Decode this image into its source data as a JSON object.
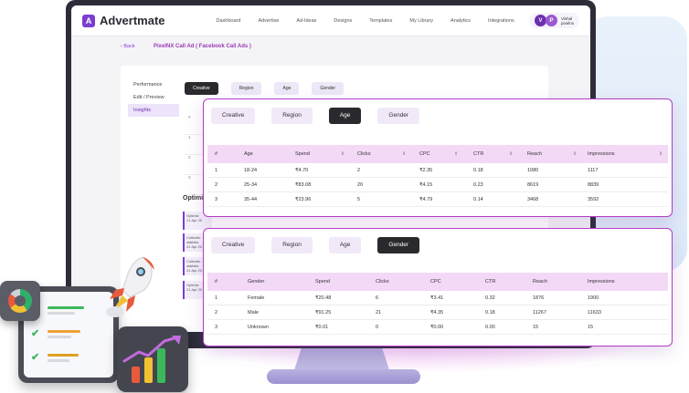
{
  "app": {
    "logo": "Advertmate",
    "nav": [
      "Dashboard",
      "Advertise",
      "Ad-Ideas",
      "Designs",
      "Templates",
      "My Library",
      "Analytics",
      "Integrations"
    ],
    "user": {
      "initial_1": "V",
      "initial_2": "P",
      "name": "Vishal",
      "sub": "pixelnx"
    },
    "back": "Back",
    "title": "PixelNX Call Ad ( Facebook Call Ads )"
  },
  "sidebar": {
    "items": [
      "Performance",
      "Edit / Preview",
      "Insights"
    ]
  },
  "bg_tabs": [
    "Creative",
    "Region",
    "Age",
    "Gender"
  ],
  "bg_rows": [
    "#",
    "1",
    "2",
    "3"
  ],
  "bg_opt": {
    "title": "Optimiz",
    "cards": [
      {
        "t": "Optimiz",
        "d": "21 Apr 20"
      },
      {
        "t": "Collectin staitstic",
        "d": "21 Apr 20"
      },
      {
        "t": "Collectin staitstic",
        "d": "21 Apr 20"
      },
      {
        "t": "Optimiz",
        "d": "21 Apr 20"
      }
    ]
  },
  "age_card": {
    "tabs": [
      "Creative",
      "Region",
      "Age",
      "Gender"
    ],
    "active_tab": "Age",
    "columns": [
      "#",
      "Age",
      "Spend",
      "Clicks",
      "CPC",
      "CTR",
      "Reach",
      "Impressions"
    ],
    "rows": [
      [
        "1",
        "18-24",
        "₹4.70",
        "2",
        "₹2.35",
        "0.18",
        "1080",
        "1117"
      ],
      [
        "2",
        "25-34",
        "₹83.08",
        "20",
        "₹4.15",
        "0.23",
        "8619",
        "8839"
      ],
      [
        "3",
        "35-44",
        "₹23.96",
        "5",
        "₹4.79",
        "0.14",
        "3468",
        "3592"
      ]
    ]
  },
  "gender_card": {
    "tabs": [
      "Creative",
      "Region",
      "Age",
      "Gender"
    ],
    "active_tab": "Gender",
    "columns": [
      "#",
      "Gender",
      "Spend",
      "Clicks",
      "CPC",
      "CTR",
      "Reach",
      "Impressions"
    ],
    "rows": [
      [
        "1",
        "Female",
        "₹20.48",
        "6",
        "₹3.41",
        "0.32",
        "1876",
        "1900"
      ],
      [
        "2",
        "Male",
        "₹91.25",
        "21",
        "₹4.35",
        "0.18",
        "11267",
        "11633"
      ],
      [
        "3",
        "Unknown",
        "₹0.01",
        "0",
        "₹0.00",
        "0.00",
        "15",
        "15"
      ]
    ]
  },
  "decor": {
    "check_icon": "check-icon",
    "rocket_icon": "rocket-icon",
    "gauge_icon": "gauge-icon",
    "chart_icon": "bar-chart-icon"
  },
  "colors": {
    "accent": "#7a3fd1",
    "card_border": "#b23cc4",
    "header_row": "#f4d9f7",
    "active_tab": "#2a2a2e"
  }
}
